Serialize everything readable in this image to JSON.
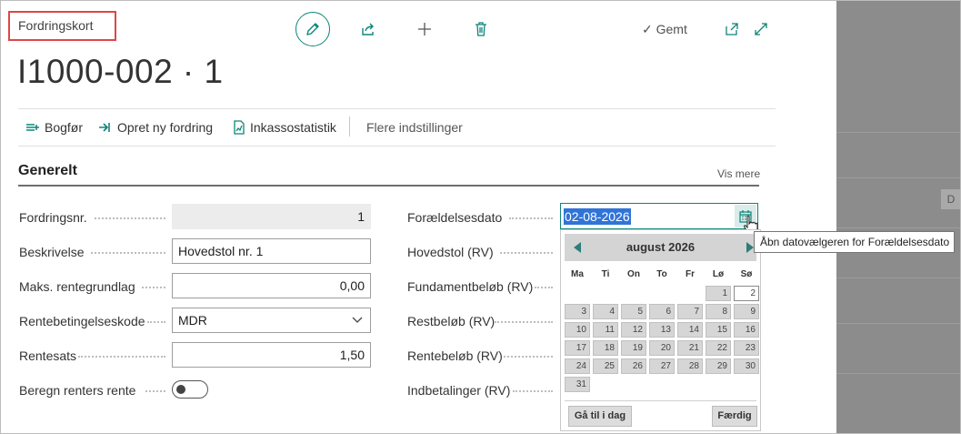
{
  "page": {
    "caption": "Fordringskort",
    "title": "I1000-002 · 1",
    "saved_status": "Gemt"
  },
  "toolbar": {
    "edit_icon": "pencil-icon",
    "share_icon": "share-icon",
    "new_icon": "plus-icon",
    "delete_icon": "trash-icon",
    "open_new_window_icon": "open-in-new-window-icon",
    "expand_icon": "expand-icon"
  },
  "actions": [
    {
      "label": "Bogfør",
      "icon": "post-icon"
    },
    {
      "label": "Opret ny fordring",
      "icon": "create-claim-icon"
    },
    {
      "label": "Inkassostatistik",
      "icon": "statistics-icon"
    },
    {
      "label": "Flere indstillinger"
    }
  ],
  "section": {
    "title": "Generelt",
    "show_more": "Vis mere"
  },
  "left_fields": {
    "claim_no": {
      "label": "Fordringsnr.",
      "value": "1"
    },
    "description": {
      "label": "Beskrivelse",
      "value": "Hovedstol nr. 1"
    },
    "max_interest_base": {
      "label": "Maks. rentegrundlag",
      "value": "0,00"
    },
    "interest_terms_code": {
      "label": "Rentebetingelseskode",
      "value": "MDR"
    },
    "interest_rate": {
      "label": "Rentesats",
      "value": "1,50"
    },
    "calc_interest_on_interest": {
      "label": "Beregn renters rente",
      "on": false
    }
  },
  "right_fields": {
    "limitation_date": {
      "label": "Forældelsesdato",
      "value": "02-08-2026"
    },
    "principal": {
      "label": "Hovedstol (RV)"
    },
    "foundation_amount": {
      "label": "Fundamentbeløb (RV)"
    },
    "remaining_amount": {
      "label": "Restbeløb (RV)"
    },
    "interest_amount": {
      "label": "Rentebeløb (RV)"
    },
    "payments": {
      "label": "Indbetalinger (RV)"
    }
  },
  "tooltip": "Åbn datovælgeren for Forældelsesdato",
  "datepicker": {
    "month_label": "august 2026",
    "weekdays": [
      "Ma",
      "Ti",
      "On",
      "To",
      "Fr",
      "Lø",
      "Sø"
    ],
    "weeks": [
      [
        "",
        "",
        "",
        "",
        "",
        "1",
        "2"
      ],
      [
        "3",
        "4",
        "5",
        "6",
        "7",
        "8",
        "9"
      ],
      [
        "10",
        "11",
        "12",
        "13",
        "14",
        "15",
        "16"
      ],
      [
        "17",
        "18",
        "19",
        "20",
        "21",
        "22",
        "23"
      ],
      [
        "24",
        "25",
        "26",
        "27",
        "28",
        "29",
        "30"
      ],
      [
        "31",
        "",
        "",
        "",
        "",
        "",
        ""
      ]
    ],
    "today": "2",
    "today_button": "Gå til i dag",
    "done_button": "Færdig"
  },
  "colors": {
    "accent": "#0e8579",
    "selection": "#3174d8",
    "caption_highlight": "#e04646"
  }
}
